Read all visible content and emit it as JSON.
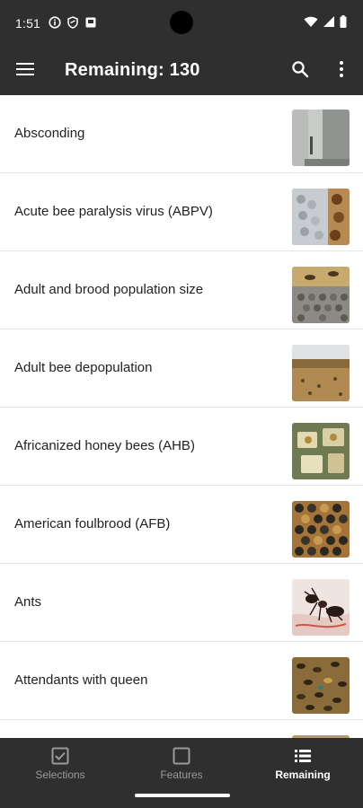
{
  "status_bar": {
    "time": "1:51",
    "left_icons": [
      "info-circle-icon",
      "shield-icon",
      "notification-square-icon"
    ],
    "right_icons": [
      "wifi-icon",
      "cellular-signal-icon",
      "battery-icon"
    ]
  },
  "app_bar": {
    "title": "Remaining: 130",
    "menu_icon": "hamburger-menu-icon",
    "search_icon": "search-icon",
    "more_icon": "more-vertical-icon"
  },
  "list": {
    "items": [
      {
        "label": "Absconding",
        "thumbnail": "absconding-photo"
      },
      {
        "label": "Acute bee paralysis virus (ABPV)",
        "thumbnail": "abpv-photo"
      },
      {
        "label": "Adult and brood population size",
        "thumbnail": "brood-population-photo"
      },
      {
        "label": "Adult bee depopulation",
        "thumbnail": "depopulation-photo"
      },
      {
        "label": "Africanized honey bees (AHB)",
        "thumbnail": "ahb-photo"
      },
      {
        "label": "American foulbrood (AFB)",
        "thumbnail": "afb-photo"
      },
      {
        "label": "Ants",
        "thumbnail": "ants-photo"
      },
      {
        "label": "Attendants with queen",
        "thumbnail": "attendants-photo"
      }
    ]
  },
  "bottom_nav": {
    "items": [
      {
        "label": "Selections",
        "icon": "checkbox-icon",
        "active": false
      },
      {
        "label": "Features",
        "icon": "square-outline-icon",
        "active": false
      },
      {
        "label": "Remaining",
        "icon": "list-icon",
        "active": true
      }
    ]
  },
  "colors": {
    "bar_background": "#2f2f2f",
    "active_nav": "#ffffff",
    "inactive_nav": "#9a9a9a",
    "divider": "#e6e6e6"
  }
}
